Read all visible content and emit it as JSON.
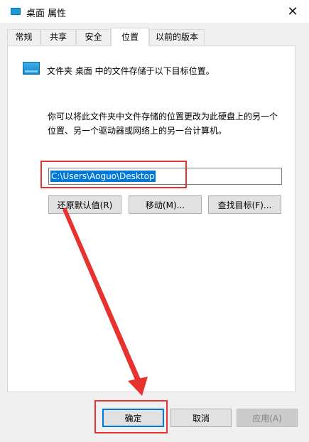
{
  "window": {
    "title": "桌面 属性",
    "close_icon": "close-icon",
    "close_glyph": "✕"
  },
  "tabs": [
    {
      "label": "常规"
    },
    {
      "label": "共享"
    },
    {
      "label": "安全"
    },
    {
      "label": "位置",
      "active": true
    },
    {
      "label": "以前的版本"
    }
  ],
  "location": {
    "heading": "文件夹 桌面 中的文件存储于以下目标位置。",
    "description_line1": "你可以将此文件夹中文件存储的位置更改为此硬盘上的另一个",
    "description_line2": "位置、另一个驱动器或网络上的另一台计算机。",
    "path_value": "C:\\Users\\Aoguo\\Desktop",
    "restore_button": "还原默认值(R)",
    "move_button": "移动(M)...",
    "find_target_button": "查找目标(F)..."
  },
  "footer": {
    "ok_button": "确定",
    "cancel_button": "取消",
    "apply_button": "应用(A)"
  },
  "annotation_color": "#e8322f",
  "selection_color": "#0078d7"
}
